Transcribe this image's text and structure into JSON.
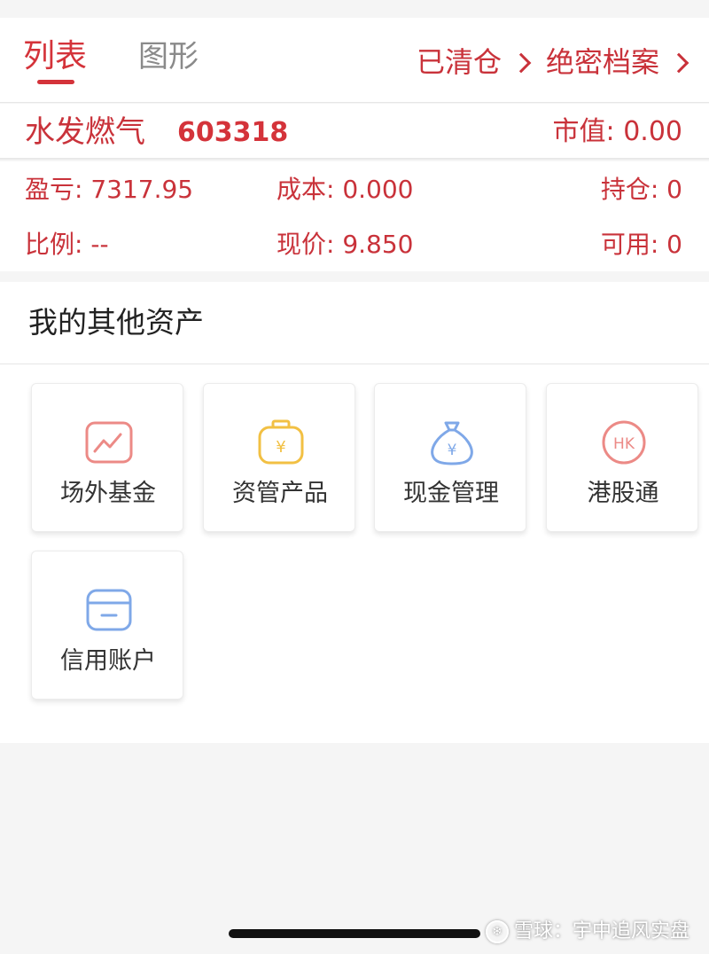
{
  "tabs": {
    "list_label": "列表",
    "chart_label": "图形",
    "cleared_label": "已清仓",
    "archive_label": "绝密档案"
  },
  "stock": {
    "name": "水发燃气",
    "code": "603318",
    "market_value": "市值: 0.00"
  },
  "stats": {
    "pnl": "盈亏: 7317.95",
    "cost": "成本: 0.000",
    "position": "持仓: 0",
    "ratio": "比例: --",
    "price": "现价: 9.850",
    "available": "可用: 0"
  },
  "assets": {
    "title": "我的其他资产",
    "items": [
      {
        "label": "场外基金",
        "icon": "chart-line-icon",
        "color": "#ec8a86"
      },
      {
        "label": "资管产品",
        "icon": "money-bag-yen-icon",
        "color": "#f2c043"
      },
      {
        "label": "现金管理",
        "icon": "money-sack-yen-icon",
        "color": "#7fa8e8"
      },
      {
        "label": "港股通",
        "icon": "hk-circle-icon",
        "color": "#ec8a86"
      },
      {
        "label": "信用账户",
        "icon": "credit-card-icon",
        "color": "#7fa8e8"
      }
    ]
  },
  "watermark": {
    "text": "雪球：宇中追风实盘"
  },
  "colors": {
    "accent": "#d4333a",
    "text_red": "#c9323a",
    "background": "#f5f5f5"
  }
}
